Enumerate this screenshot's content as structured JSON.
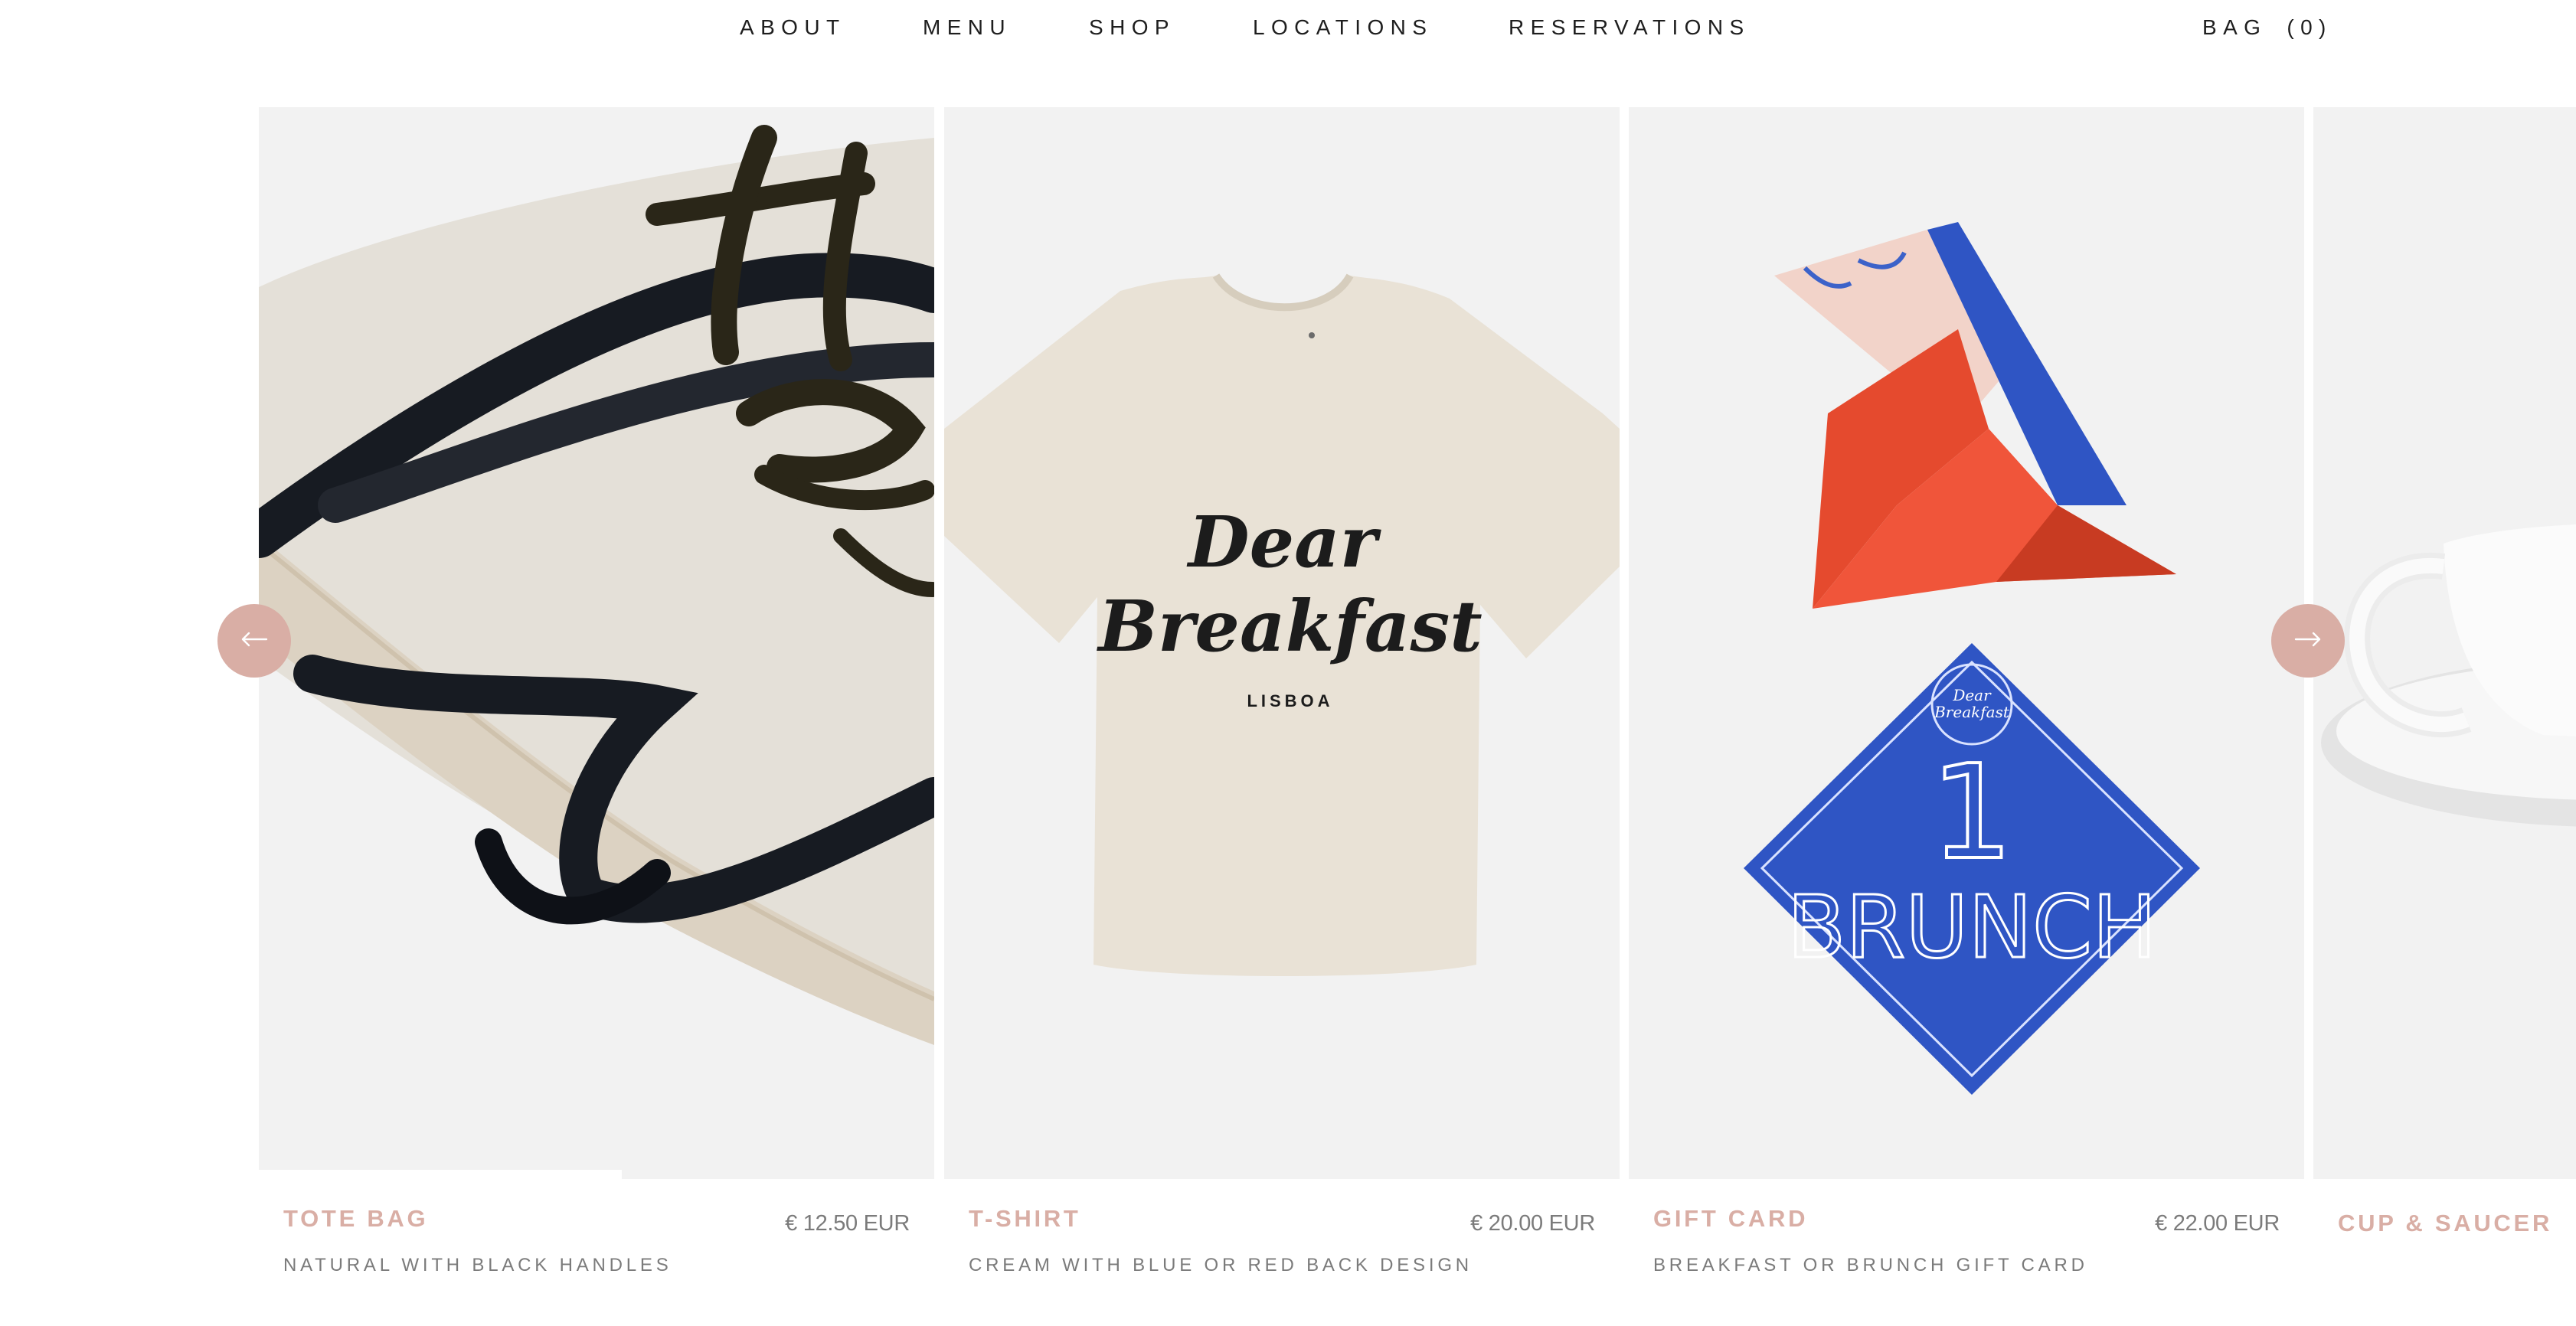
{
  "nav": {
    "items": [
      "ABOUT",
      "MENU",
      "SHOP",
      "LOCATIONS",
      "RESERVATIONS"
    ],
    "bag_label": "BAG",
    "bag_count": "(0)"
  },
  "colors": {
    "accent": "#d9aea5",
    "tile": "#f2f2f2",
    "text": "#1e1e1e",
    "muted": "#7b7b7b"
  },
  "carousel": {
    "prev_icon": "arrow-left-icon",
    "next_icon": "arrow-right-icon",
    "products": [
      {
        "name": "TOTE BAG",
        "price": "€ 12.50 EUR",
        "description": "NATURAL WITH BLACK HANDLES"
      },
      {
        "name": "T-SHIRT",
        "price": "€ 20.00 EUR",
        "description": "CREAM WITH BLUE OR RED BACK DESIGN",
        "print_title_1": "Dear",
        "print_title_2": "Breakfast",
        "print_city": "LISBOA"
      },
      {
        "name": "GIFT CARD",
        "price": "€ 22.00 EUR",
        "description": "BREAKFAST OR BRUNCH GIFT CARD",
        "card_number": "1",
        "card_word": "BRUNCH",
        "card_logo_1": "Dear",
        "card_logo_2": "Breakfast"
      },
      {
        "name": "CUP & SAUCER"
      }
    ]
  }
}
